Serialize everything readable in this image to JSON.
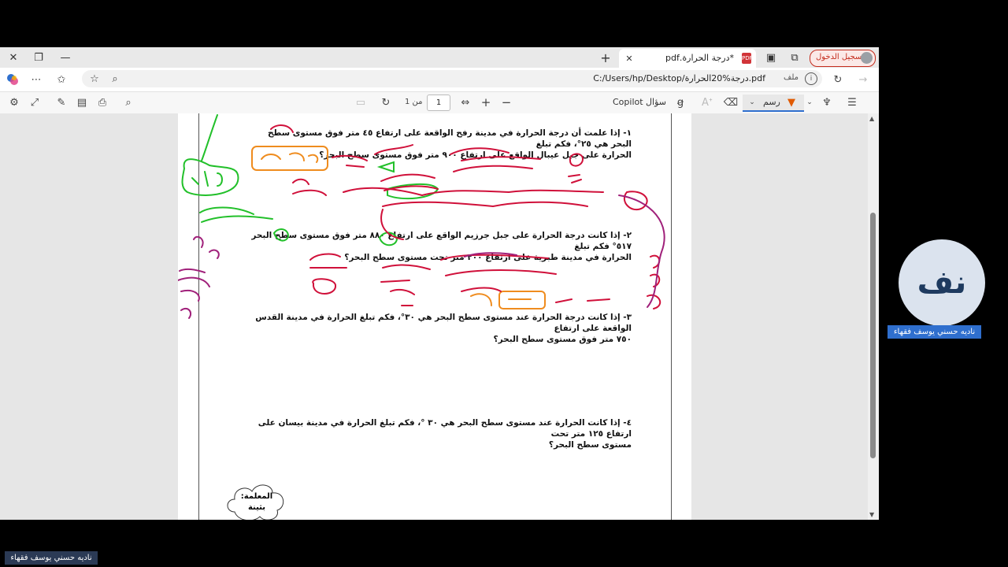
{
  "browser": {
    "tab_title": "*درجة الحرارة.pdf",
    "sign_in_label": "تسجيل الدخول",
    "address": "C:/Users/hp/Desktop/درجة%20الحرارة.pdf",
    "address_prefix": "ملف"
  },
  "pdf_toolbar": {
    "page_number": "1",
    "page_of": "من 1",
    "copilot_label": "سؤال Copilot",
    "draw_label": "رسم"
  },
  "document": {
    "q1_line1": "١- إذا علمت أن درجة الحرارة في مدينة رفح الواقعة على ارتفاع ٤٥ متر فوق مستوى سطح البحر هي ٢٥°، فكم تبلغ",
    "q1_line2": "الحرارة على جبل عيبال الواقع على ارتفاع ٩٠٠ متر فوق مستوى سطح البحر؟",
    "q2_line1": "٢- إذا كانت درجة الحرارة على جبل جرزيم الواقع على ارتفاع ٨٨٠ متر فوق مستوى سطح البحر ٥١٧° فكم تبلغ",
    "q2_line2": "الحرارة في مدينة طبرية على ارتفاع ٢٠٠ متر تحت مستوى سطح البحر؟",
    "q3_line1": "٣- إذا كانت درجة الحرارة عند مستوى سطح البحر هي ٣٠°، فكم تبلغ الحرارة في مدينة القدس الواقعة على ارتفاع",
    "q3_line2": "٧٥٠ متر فوق مستوى سطح البحر؟",
    "q4_line1": "٤- إذا كانت الحرارة عند مستوى سطح البحر هي ٣٠ °، فكم تبلغ الحرارة في مدينة بيسان على ارتفاع ١٢٥ متر تحت",
    "q4_line2": "مستوى سطح البحر؟",
    "teacher_label": "المعلمة:",
    "teacher_name": "بثينة"
  },
  "participant": {
    "initials": "نف",
    "name": "ناديه حسني يوسف فقهاء"
  },
  "presenter_name": "ناديه حسني يوسف فقهاء",
  "colors": {
    "ink_green": "#22c02a",
    "ink_red": "#d0103a",
    "ink_orange": "#ef8c1e",
    "ink_purple": "#a0207a",
    "accent": "#2f6fce"
  }
}
